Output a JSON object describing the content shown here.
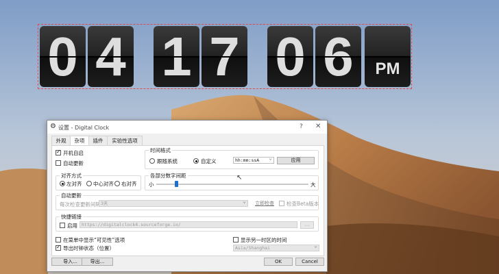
{
  "clock": {
    "digits": [
      "0",
      "4",
      "1",
      "7",
      "0",
      "6"
    ],
    "ampm": "PM"
  },
  "dialog": {
    "title": "设置 - Digital Clock",
    "help_label": "?",
    "close_label": "✕",
    "tabs": [
      "外观",
      "杂项",
      "插件",
      "实验性选项"
    ],
    "active_tab": "杂项",
    "autostart_label": "开机自启",
    "autoupdate_label": "自动更新",
    "time_format": {
      "title": "时间格式",
      "follow_system": "跟随系统",
      "custom": "自定义",
      "format_value": "hh:mm:ssA",
      "apply": "应用"
    },
    "alignment": {
      "title": "对齐方式",
      "left": "左对齐",
      "center": "中心对齐",
      "right": "右对齐"
    },
    "spacing": {
      "title": "各部分数字间距",
      "min_label": "小",
      "max_label": "大",
      "level": 0.12
    },
    "auto_update": {
      "title": "自动更新",
      "interval_label": "每次检查更新间隔",
      "interval_value": "3天",
      "check_now": "立即检查",
      "beta_label": "检查Beta版本"
    },
    "quick_link": {
      "title": "快捷链接",
      "enable_label": "启用",
      "url_placeholder": "https://digitalclock4.sourceforge.io/",
      "browse": "..."
    },
    "show_visibility_label": "在菜单中显示“可见性”选项",
    "export_state_label": "导出时钟状态（位置）",
    "other_tz_label": "显示另一时区的时间",
    "timezone_value": "Asia/Shanghai",
    "import_btn": "导入...",
    "export_btn": "导出...",
    "ok_btn": "OK",
    "cancel_btn": "Cancel"
  }
}
